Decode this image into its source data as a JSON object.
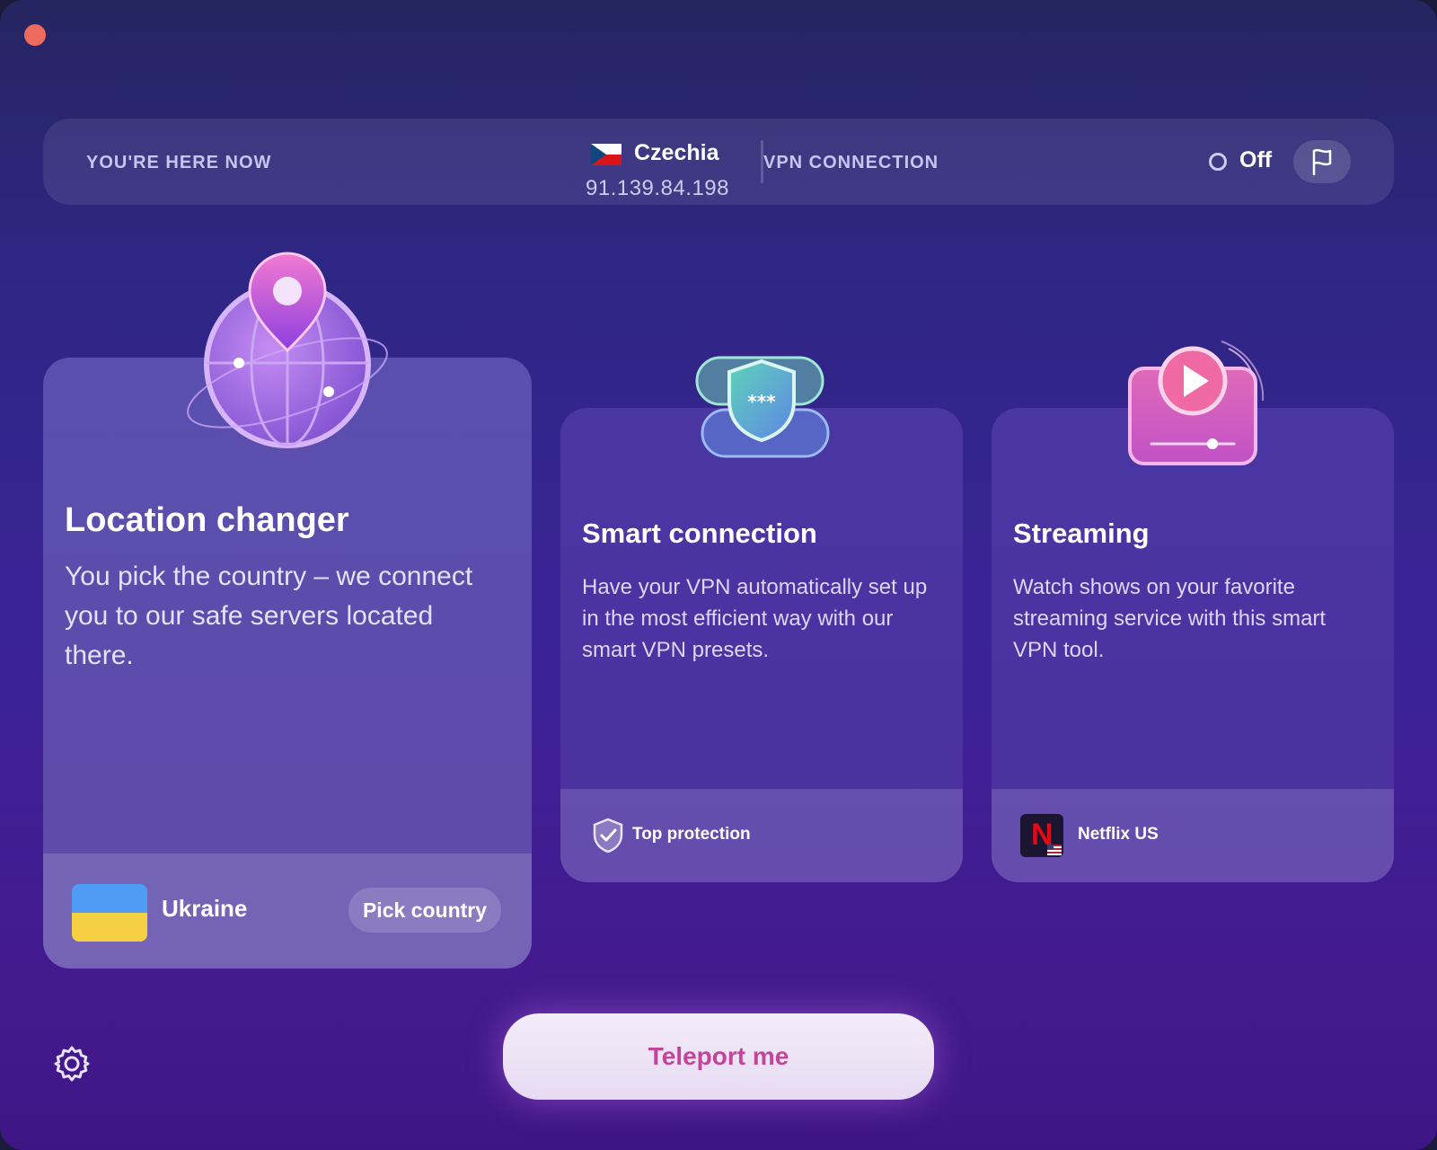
{
  "status_bar": {
    "here_label": "YOU'RE HERE NOW",
    "country": "Czechia",
    "ip": "91.139.84.198",
    "vpn_label": "VPN CONNECTION",
    "vpn_status": "Off"
  },
  "cards": [
    {
      "title": "Location changer",
      "description": "You pick the country – we connect you to our safe servers located there.",
      "illustration": "globe-pin-icon",
      "footer": {
        "country": "Ukraine",
        "button": "Pick country",
        "flag": "ukraine-flag"
      }
    },
    {
      "title": "Smart connection",
      "description": "Have your VPN automatically set up in the most efficient way with our smart VPN presets.",
      "illustration": "shield-password-icon",
      "footer": {
        "label": "Top protection",
        "icon": "shield-check-icon"
      }
    },
    {
      "title": "Streaming",
      "description": "Watch shows on your favorite streaming service with this smart VPN tool.",
      "illustration": "play-screen-icon",
      "footer": {
        "label": "Netflix US",
        "icon": "netflix-icon"
      }
    }
  ],
  "actions": {
    "teleport": "Teleport me"
  },
  "colors": {
    "accent": "#c2459a",
    "close_dot": "#ee6a5f",
    "ukraine_blue": "#4f9cf5",
    "ukraine_yellow": "#f5d042"
  }
}
